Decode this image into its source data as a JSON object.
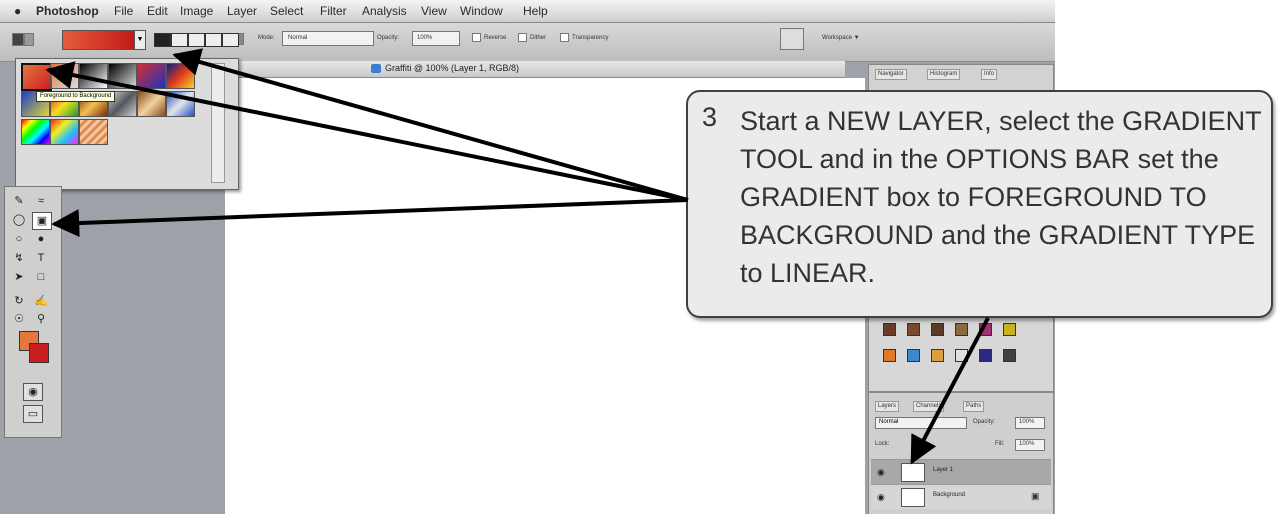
{
  "menubar": {
    "apple_icon": "apple-icon",
    "app_name": "Photoshop",
    "items": [
      "File",
      "Edit",
      "Image",
      "Layer",
      "Select",
      "Filter",
      "Analysis",
      "View",
      "Window",
      "Help"
    ]
  },
  "options_bar": {
    "mode_label": "Mode:",
    "mode_value": "Normal",
    "opacity_label": "Opacity:",
    "opacity_value": "100%",
    "reverse_label": "Reverse",
    "dither_label": "Dither",
    "transparency_label": "Transparency",
    "workspace_label": "Workspace ▼",
    "gradient_colors": [
      "#e45b3b",
      "#c11b17"
    ]
  },
  "document": {
    "title": "Graffiti @ 100% (Layer 1, RGB/8)"
  },
  "gradient_picker": {
    "tooltip": "Foreground to Background"
  },
  "panels": {
    "nav_tabs": [
      "Navigator",
      "Histogram",
      "Info"
    ],
    "layers_tabs": [
      "Layers",
      "Channels",
      "Paths"
    ],
    "blend_mode": "Normal",
    "opacity_label": "Opacity:",
    "opacity_value": "100%",
    "lock_label": "Lock:",
    "fill_label": "Fill:",
    "fill_value": "100%",
    "layers": [
      "Layer 1",
      "Background"
    ]
  },
  "callout": {
    "number": "3",
    "text": "Start a NEW LAYER, select the GRADIENT TOOL and in the OPTIONS BAR set the GRADIENT box to FOREGROUND TO BACKGROUND and the GRADIENT TYPE to LINEAR."
  },
  "colors": {
    "foreground": "#e3773e",
    "background": "#cc1e22"
  }
}
